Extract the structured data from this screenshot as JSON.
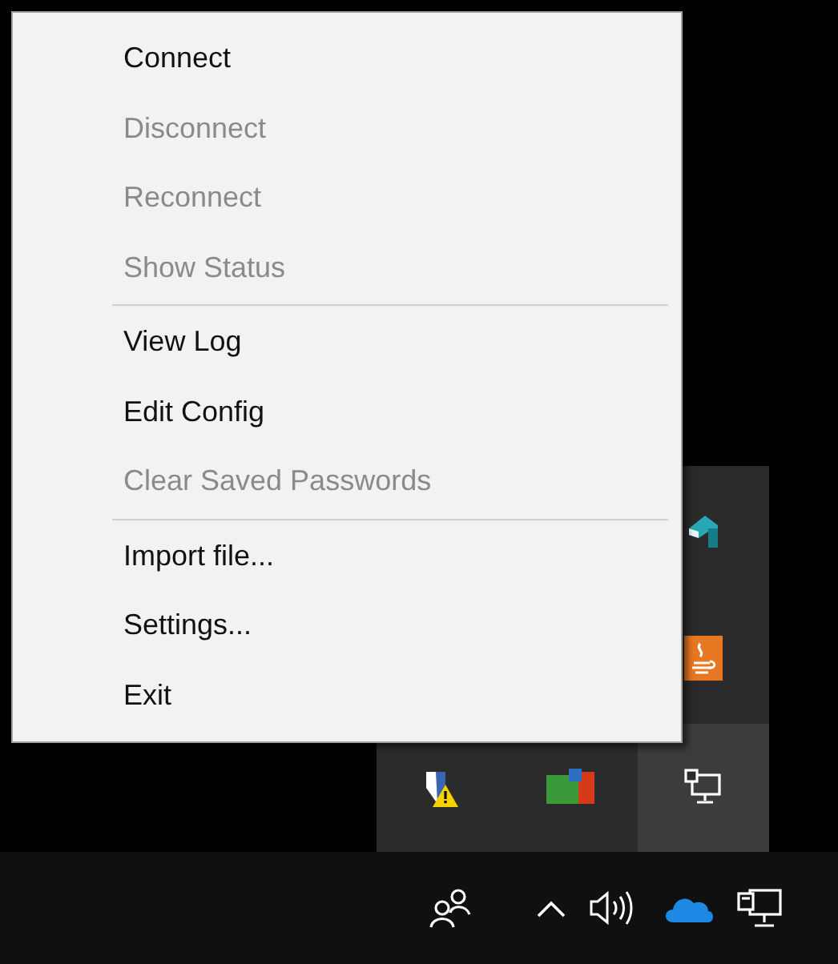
{
  "menu": {
    "items": [
      {
        "kind": "item",
        "label": "Connect",
        "disabled": false
      },
      {
        "kind": "item",
        "label": "Disconnect",
        "disabled": true
      },
      {
        "kind": "item",
        "label": "Reconnect",
        "disabled": true
      },
      {
        "kind": "item",
        "label": "Show Status",
        "disabled": true
      },
      {
        "kind": "separator"
      },
      {
        "kind": "item",
        "label": "View Log",
        "disabled": false
      },
      {
        "kind": "item",
        "label": "Edit Config",
        "disabled": false
      },
      {
        "kind": "item",
        "label": "Clear Saved Passwords",
        "disabled": true
      },
      {
        "kind": "separator"
      },
      {
        "kind": "item",
        "label": "Import file...",
        "disabled": false
      },
      {
        "kind": "item",
        "label": "Settings...",
        "disabled": false
      },
      {
        "kind": "item",
        "label": "Exit",
        "disabled": false
      }
    ]
  }
}
